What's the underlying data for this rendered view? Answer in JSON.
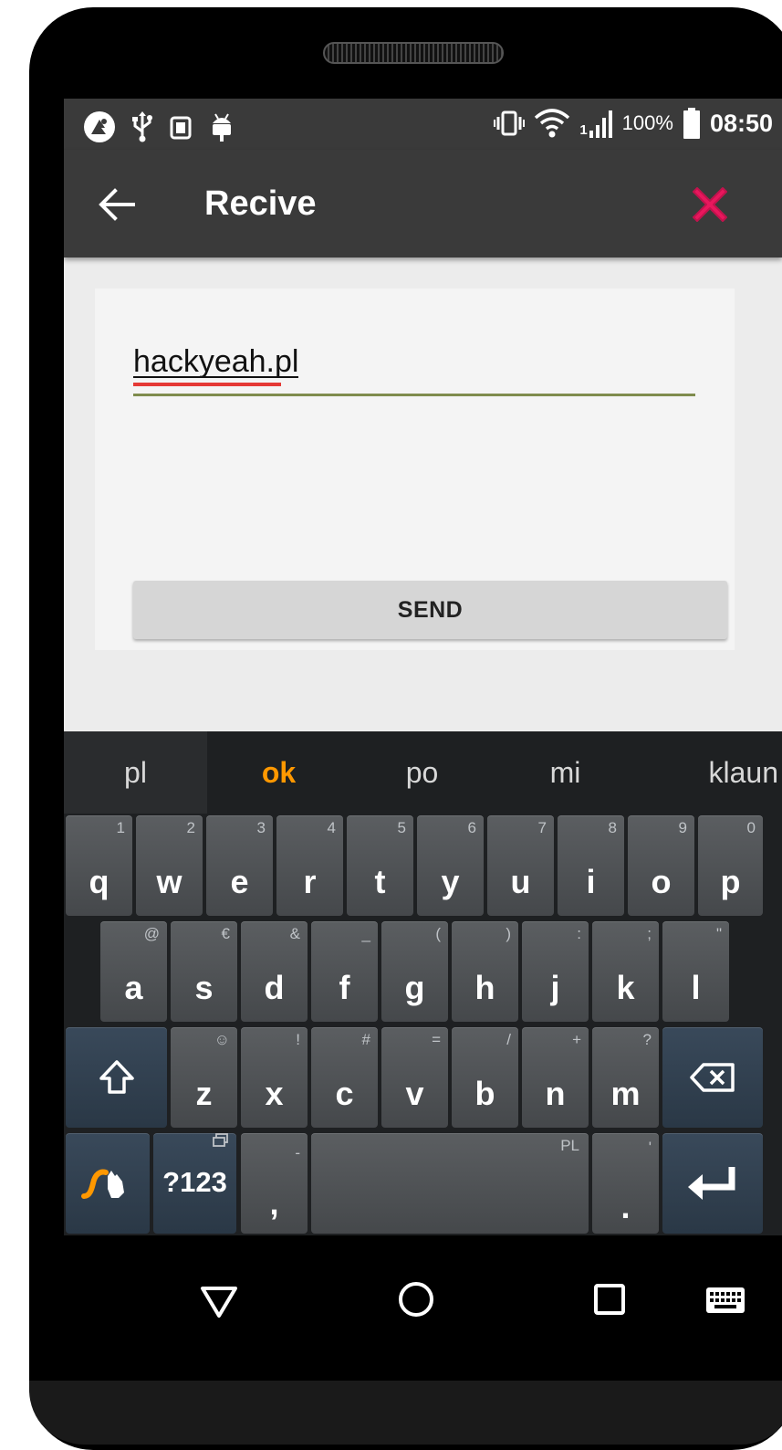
{
  "status_bar": {
    "battery_percent": "100%",
    "time": "08:50",
    "icons": [
      "maps-icon",
      "usb-icon",
      "sim-icon",
      "android-debug-icon",
      "vibrate-icon",
      "wifi-icon",
      "signal-icon",
      "battery-icon"
    ],
    "signal_sim_label": "1"
  },
  "toolbar": {
    "title": "Recive",
    "back_icon": "arrow-left-icon",
    "close_icon": "close-x-icon",
    "close_color": "#e8175d"
  },
  "form": {
    "input_value": "hackyeah.pl",
    "send_label": "SEND",
    "underline_color": "#7f8c4d"
  },
  "keyboard": {
    "suggestions": [
      "pl",
      "ok",
      "po",
      "mi",
      "klaun"
    ],
    "accent_color": "#ff9800",
    "row1": [
      {
        "key": "q",
        "hint": "1"
      },
      {
        "key": "w",
        "hint": "2"
      },
      {
        "key": "e",
        "hint": "3"
      },
      {
        "key": "r",
        "hint": "4"
      },
      {
        "key": "t",
        "hint": "5"
      },
      {
        "key": "y",
        "hint": "6"
      },
      {
        "key": "u",
        "hint": "7"
      },
      {
        "key": "i",
        "hint": "8"
      },
      {
        "key": "o",
        "hint": "9"
      },
      {
        "key": "p",
        "hint": "0"
      }
    ],
    "row2": [
      {
        "key": "a",
        "hint": "@"
      },
      {
        "key": "s",
        "hint": "€"
      },
      {
        "key": "d",
        "hint": "&"
      },
      {
        "key": "f",
        "hint": "_"
      },
      {
        "key": "g",
        "hint": "("
      },
      {
        "key": "h",
        "hint": ")"
      },
      {
        "key": "j",
        "hint": ":"
      },
      {
        "key": "k",
        "hint": ";"
      },
      {
        "key": "l",
        "hint": "\""
      }
    ],
    "row3": [
      {
        "key": "z",
        "hint": "☺"
      },
      {
        "key": "x",
        "hint": "!"
      },
      {
        "key": "c",
        "hint": "#"
      },
      {
        "key": "v",
        "hint": "="
      },
      {
        "key": "b",
        "hint": "/"
      },
      {
        "key": "n",
        "hint": "+"
      },
      {
        "key": "m",
        "hint": "?"
      }
    ],
    "symbols_label": "?123",
    "comma_key": ",",
    "comma_hint": "-",
    "space_hint": "PL",
    "period_key": ".",
    "period_hint": "'"
  },
  "nav_bar": {
    "icons": [
      "back-triangle-icon",
      "home-circle-icon",
      "recents-square-icon",
      "keyboard-icon"
    ]
  }
}
